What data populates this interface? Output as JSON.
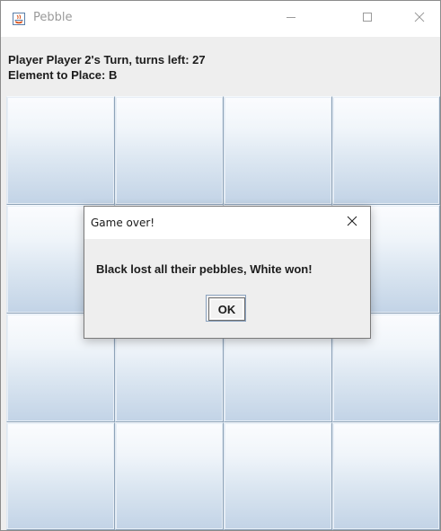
{
  "window": {
    "title": "Pebble",
    "icon": "java-cup-icon",
    "controls": [
      "minimize-icon",
      "maximize-icon",
      "close-icon"
    ]
  },
  "status": {
    "turn_line": "Player Player 2's Turn, turns left: 27",
    "element_line": "Element to Place: B"
  },
  "board": {
    "rows": 4,
    "cols": 4,
    "cells": [
      "",
      "",
      "",
      "",
      "",
      "",
      "",
      "",
      "",
      "",
      "",
      "",
      "",
      "",
      "",
      ""
    ]
  },
  "dialog": {
    "title": "Game over!",
    "message": "Black lost all their pebbles, White won!",
    "ok_label": "OK",
    "close_icon": "close-icon"
  },
  "colors": {
    "cell_top": "#fbfcfe",
    "cell_bottom": "#c2d3e6",
    "cell_border": "#8ea3b8",
    "panel_background": "#eeeeee",
    "title_text": "#9a9a9a"
  }
}
